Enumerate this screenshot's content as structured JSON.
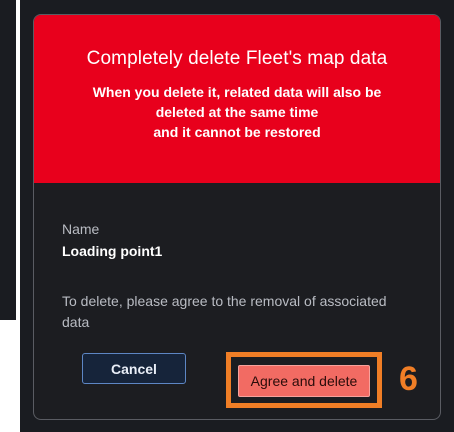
{
  "dialog": {
    "title": "Completely delete Fleet's map data",
    "description_line1": "When you delete it, related data will also be",
    "description_line2": "deleted at the same time",
    "description_line3": "and it cannot be restored",
    "field_label": "Name",
    "field_value": "Loading point1",
    "agree_note": "To delete, please agree to the removal of associated data",
    "cancel_label": "Cancel",
    "agree_label": "Agree and delete"
  },
  "annotation": {
    "step_number": "6"
  },
  "colors": {
    "header_red": "#e8001c",
    "dialog_bg": "#1c1d21",
    "highlight_orange": "#f07e26",
    "agree_button": "#f26b63"
  }
}
